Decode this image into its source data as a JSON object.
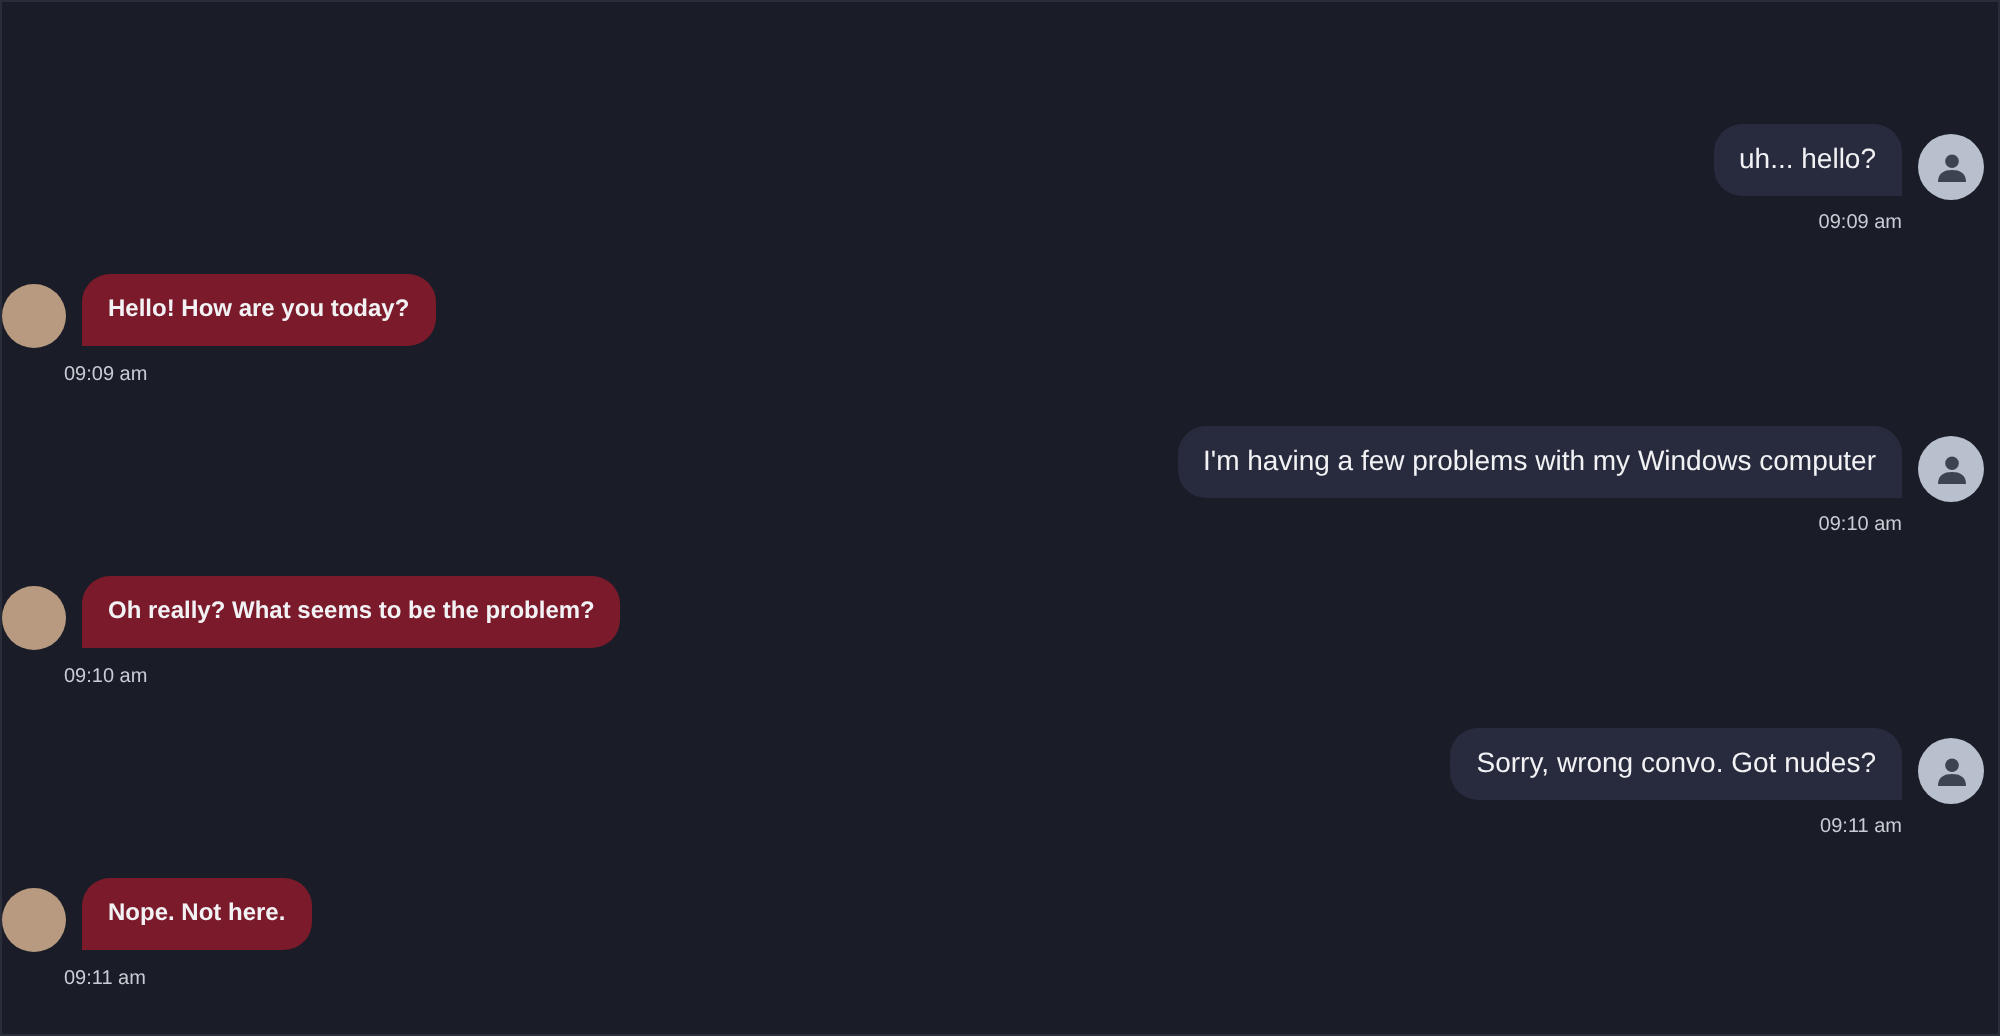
{
  "messages": [
    {
      "kind": "user",
      "text": "uh... hello?",
      "time": "09:09 am"
    },
    {
      "kind": "bot",
      "text": "Hello! How are you today?",
      "time": "09:09 am"
    },
    {
      "kind": "user",
      "text": "I'm having a few problems with my Windows computer",
      "time": "09:10 am"
    },
    {
      "kind": "bot",
      "text": "Oh really? What seems to be the problem?",
      "time": "09:10 am"
    },
    {
      "kind": "user",
      "text": "Sorry, wrong convo. Got nudes?",
      "time": "09:11 am"
    },
    {
      "kind": "bot",
      "text": "Nope. Not here.",
      "time": "09:11 am"
    }
  ]
}
